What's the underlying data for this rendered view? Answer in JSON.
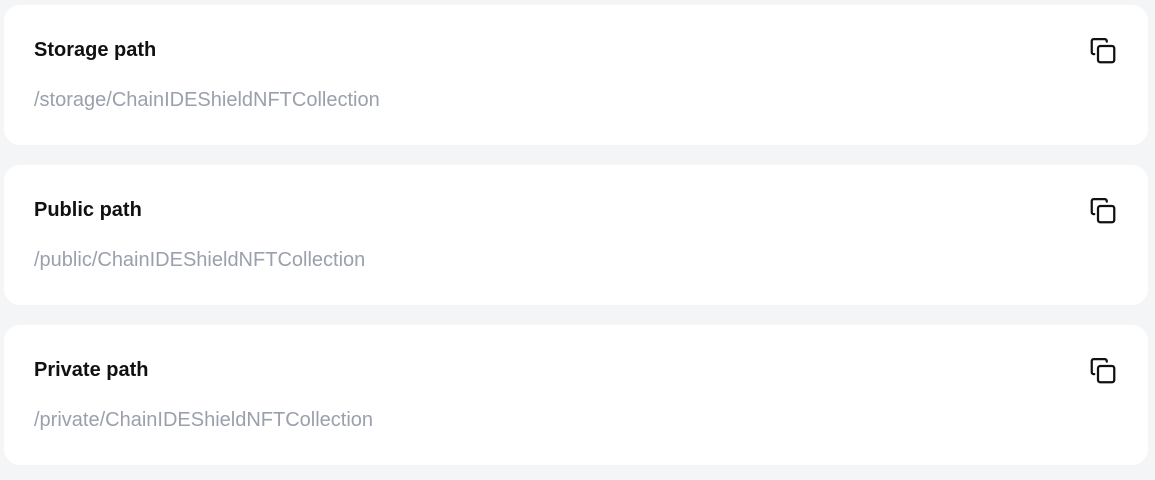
{
  "paths": [
    {
      "title": "Storage path",
      "value": "/storage/ChainIDEShieldNFTCollection",
      "icon": "copy-icon"
    },
    {
      "title": "Public path",
      "value": "/public/ChainIDEShieldNFTCollection",
      "icon": "copy-icon"
    },
    {
      "title": "Private path",
      "value": "/private/ChainIDEShieldNFTCollection",
      "icon": "copy-icon"
    }
  ],
  "colors": {
    "page_background": "#f4f5f7",
    "card_background": "#ffffff",
    "title_text": "#111111",
    "value_text": "#9aa0ac",
    "icon_stroke": "#111111"
  }
}
